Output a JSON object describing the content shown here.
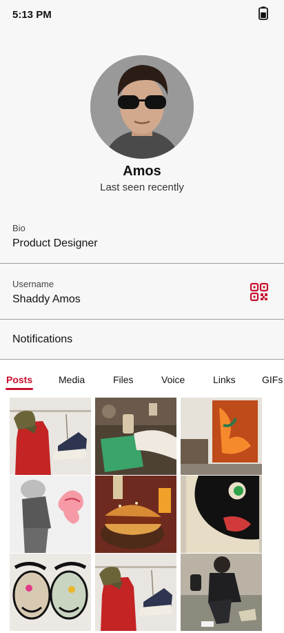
{
  "status_bar": {
    "time": "5:13 PM",
    "battery_icon": "battery-icon"
  },
  "profile": {
    "name": "Amos",
    "status": "Last seen recently"
  },
  "bio": {
    "caption": "Bio",
    "value": "Product Designer"
  },
  "username": {
    "caption": "Username",
    "value": "Shaddy  Amos",
    "action_icon": "qr-code-icon"
  },
  "notifications": {
    "label": "Notifications"
  },
  "tabs": [
    {
      "label": "Posts",
      "active": true
    },
    {
      "label": "Media"
    },
    {
      "label": "Files"
    },
    {
      "label": "Voice"
    },
    {
      "label": "Links"
    },
    {
      "label": "GIFs"
    }
  ],
  "colors": {
    "accent": "#c8102e",
    "background": "#f7f7f7",
    "divider": "#9e9e9e"
  },
  "posts": [
    "red-jacket-cap-sneakers",
    "drinks-on-table",
    "orange-painting",
    "kaws-figures",
    "burger-meal",
    "pop-art-face",
    "graffiti-art",
    "red-jacket-cap-sneakers",
    "person-on-sofa"
  ]
}
